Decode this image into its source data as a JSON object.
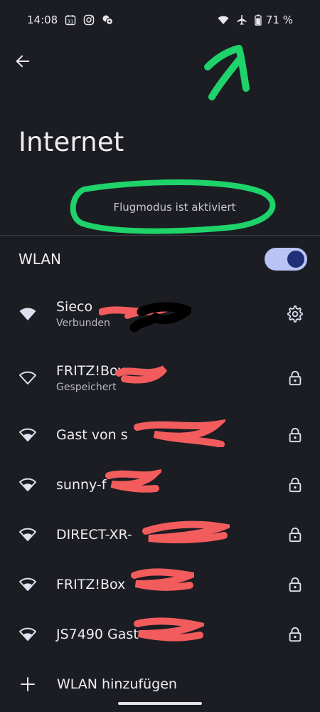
{
  "status_bar": {
    "time": "14:08",
    "calendar_day": "31",
    "battery": "71 %",
    "left_icons": [
      "calendar-icon",
      "instagram-icon",
      "notification-icon"
    ],
    "right_icons": [
      "wifi-icon",
      "airplane-icon",
      "battery-icon"
    ]
  },
  "header": {
    "title": "Internet",
    "back_icon": "back-arrow-icon"
  },
  "notice": "Flugmodus ist aktiviert",
  "wlan": {
    "label": "WLAN",
    "enabled": true
  },
  "networks": [
    {
      "name": "Sieco",
      "subtitle": "Verbunden",
      "signal": "full",
      "right_icon": "gear-icon"
    },
    {
      "name": "FRITZ!Box",
      "subtitle": "Gespeichert",
      "signal": "outline",
      "right_icon": "lock-icon"
    },
    {
      "name": "Gast von s",
      "subtitle": "",
      "signal": "strong",
      "right_icon": "lock-icon"
    },
    {
      "name": "sunny-f",
      "subtitle": "",
      "signal": "strong",
      "right_icon": "lock-icon"
    },
    {
      "name": "DIRECT-XR-",
      "subtitle": "",
      "signal": "strong",
      "right_icon": "lock-icon"
    },
    {
      "name": "FRITZ!Box",
      "subtitle": "",
      "signal": "strong",
      "right_icon": "lock-icon"
    },
    {
      "name": "JS7490 Gast",
      "subtitle": "",
      "signal": "strong",
      "right_icon": "lock-icon"
    }
  ],
  "add_network": {
    "label": "WLAN hinzufügen",
    "icon": "plus-icon"
  },
  "colors": {
    "background": "#1b1d23",
    "toggle_track": "#b9c3f4",
    "toggle_knob": "#1f2f7a",
    "annotation_green": "#1ed36a",
    "redaction_red": "#f25c5c"
  }
}
